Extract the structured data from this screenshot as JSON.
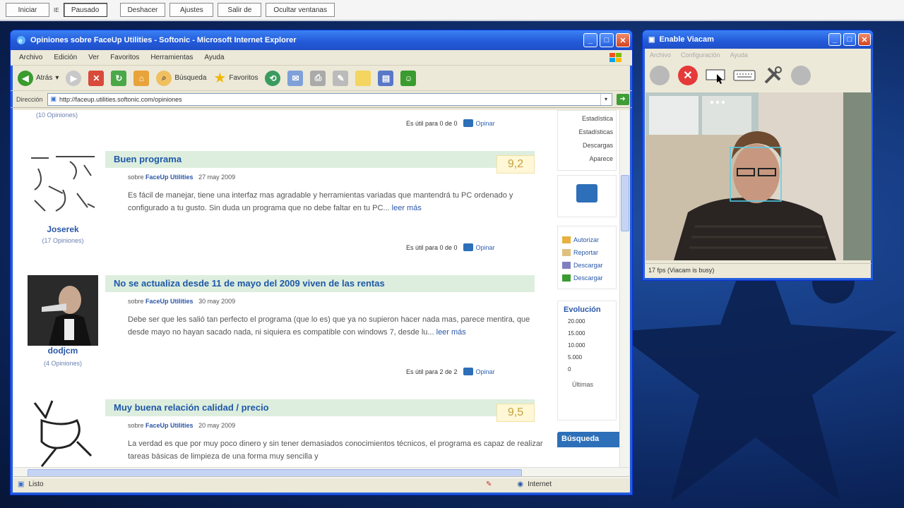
{
  "topbar": {
    "buttons": [
      "Iniciar",
      "Pausado",
      "Deshacer",
      "Ajustes",
      "Salir de",
      "Ocultar ventanas"
    ],
    "ie_label": "IE"
  },
  "ie": {
    "title": "Opiniones sobre FaceUp Utilities - Softonic - Microsoft Internet Explorer",
    "menu": [
      "Archivo",
      "Edición",
      "Ver",
      "Favoritos",
      "Herramientas",
      "Ayuda"
    ],
    "toolbar": {
      "back": "Atrás",
      "search": "Búsqueda",
      "favorites": "Favoritos"
    },
    "address_label": "Dirección",
    "address": "http://faceup.utilities.softonic.com/opiniones",
    "status_left": "Listo",
    "status_zone": "Internet",
    "content": {
      "snippet_top": "(10 Opiniones)",
      "util_text": "Es útil para",
      "opinar": "Opinar",
      "reviews": [
        {
          "user": "Joserek",
          "count": "(17 Opiniones)",
          "title": "Buen programa",
          "score": "9,2",
          "meta_prefix": "sobre",
          "meta_app": "FaceUp Utilities",
          "date": "27 may 2009",
          "text": "Es fácil de manejar, tiene una interfaz mas agradable y herramientas variadas que mantendrá tu PC ordenado y configurado a tu gusto. Sin duda un programa que no debe faltar en tu PC...",
          "more": "leer más",
          "util": "Es útil para 0 de 0"
        },
        {
          "user": "dodjcm",
          "count": "(4 Opiniones)",
          "title": "No se actualiza desde 11 de mayo del 2009 viven de las rentas",
          "score": "",
          "meta_prefix": "sobre",
          "meta_app": "FaceUp Utilities",
          "date": "30 may 2009",
          "text": "Debe ser que les salió tan perfecto el programa (que lo es) que ya no supieron hacer nada mas, parece mentira, que desde mayo no hayan sacado nada, ni siquiera es compatible con windows 7, desde lu...",
          "more": "leer más",
          "util": "Es útil para 2 de 2"
        },
        {
          "user": "",
          "count": "",
          "title": "Muy buena relación calidad / precio",
          "score": "9,5",
          "meta_prefix": "sobre",
          "meta_app": "FaceUp Utilities",
          "date": "20 may 2009",
          "text": "La verdad es que por muy poco dinero y sin tener demasiados conocimientos técnicos, el programa es capaz de realizar tareas básicas de limpieza de una forma muy sencilla y",
          "more": "",
          "util": ""
        }
      ],
      "first_util": "Es útil para 0 de 0"
    },
    "right_col": {
      "list": [
        "Estadística",
        "Estadísticas",
        "Descargas",
        "Aparece"
      ],
      "links": [
        "Autorizar",
        "Reportar",
        "Descargar",
        "Descargar"
      ],
      "evol_title": "Evolución",
      "axis": [
        "20.000",
        "15.000",
        "10.000",
        "5.000",
        "0"
      ],
      "legend": "Últimas",
      "busq": "Búsqueda"
    }
  },
  "cam": {
    "title": "Enable Viacam",
    "menu": [
      "Archivo",
      "Configuración",
      "Ayuda"
    ],
    "status": "17 fps (Viacam is busy)"
  },
  "colors": {
    "accent": "#2359d8",
    "link": "#2a57a8",
    "review_title_bg": "#ddeede",
    "score_text": "#c4a23a"
  }
}
